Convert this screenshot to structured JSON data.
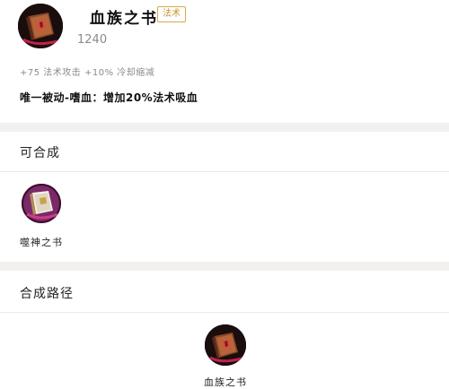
{
  "item": {
    "name": "血族之书",
    "tag": "法术",
    "price": "1240",
    "stats": "+75 法术攻击 +10% 冷却缩减",
    "passive": "唯一被动-嗜血：增加20%法术吸血",
    "icon": "blood-book-icon"
  },
  "sections": {
    "compose_into_title": "可合成",
    "compose_path_title": "合成路径"
  },
  "compose_into": [
    {
      "name": "噬神之书",
      "icon": "god-eater-book-icon"
    }
  ],
  "compose_path": [
    {
      "name": "血族之书",
      "icon": "blood-book-icon"
    }
  ],
  "colors": {
    "tag_border": "#d8a94a",
    "tag_text": "#c9912f",
    "section_divider": "#f3f1ef"
  }
}
